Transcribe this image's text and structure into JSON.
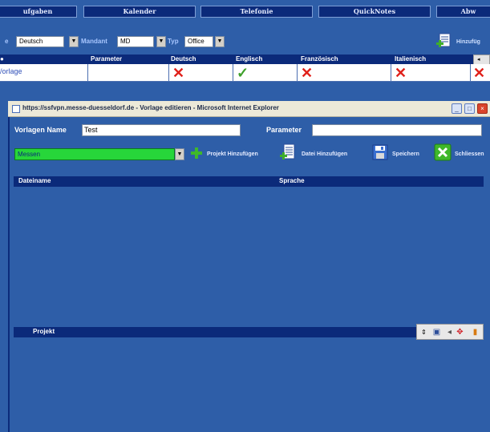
{
  "nav": {
    "tabs": [
      {
        "label": "ufgaben"
      },
      {
        "label": "Kalender"
      },
      {
        "label": "Telefonie"
      },
      {
        "label": "QuickNotes"
      },
      {
        "label": "Abw"
      }
    ]
  },
  "filters": {
    "language_value": "Deutsch",
    "mandant_label": "Mandant",
    "mandant_value": "MD",
    "typ_label": "Typ",
    "typ_value": "Office",
    "add_label": "Hinzufüg",
    "lang_label_fragment": "e"
  },
  "lang_table": {
    "columns": [
      "Parameter",
      "Deutsch",
      "Englisch",
      "Französisch",
      "Italienisch"
    ],
    "row": {
      "vorlage_link": "/orlage",
      "parameter": "",
      "deutsch": "✕",
      "englisch": "✓",
      "franzoesisch": "✕",
      "italienisch": "✕",
      "extra": "✕"
    }
  },
  "popup": {
    "title": "https://ssfvpn.messe-duesseldorf.de - Vorlage editieren - Microsoft Internet Explorer",
    "vorlagen_name_label": "Vorlagen Name",
    "vorlagen_name_value": "Test",
    "parameter_label": "Parameter",
    "parameter_value": "",
    "project_select_value": "Messen",
    "add_project_label": "Projekt Hinzufügen",
    "add_file_label": "Datei Hinzufügen",
    "save_label": "Speichern",
    "close_label": "Schliessen",
    "file_table": {
      "columns": [
        "Dateiname",
        "Sprache"
      ]
    },
    "project_header": "Projekt"
  }
}
